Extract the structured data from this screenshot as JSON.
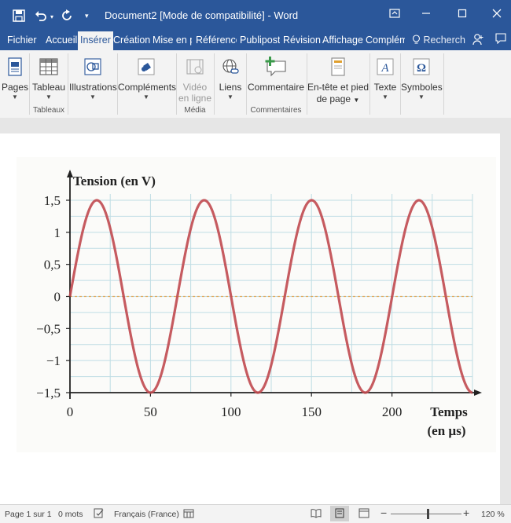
{
  "app": {
    "title": "Document2 [Mode de compatibilité]  -  Word"
  },
  "tabs": [
    {
      "label": "Fichier"
    },
    {
      "label": "Accueil"
    },
    {
      "label": "Insérer"
    },
    {
      "label": "Création"
    },
    {
      "label": "Mise en p"
    },
    {
      "label": "Référence"
    },
    {
      "label": "Publiposti"
    },
    {
      "label": "Révision"
    },
    {
      "label": "Affichage"
    },
    {
      "label": "Complém"
    }
  ],
  "tell_me": "Recherch",
  "ribbon": {
    "pages": "Pages",
    "tableau": "Tableau",
    "tableaux_group": "Tableaux",
    "illustrations": "Illustrations",
    "complements": "Compléments",
    "video_line1": "Vidéo",
    "video_line2": "en ligne",
    "media_group": "Média",
    "liens": "Liens",
    "commentaire": "Commentaire",
    "commentaires_group": "Commentaires",
    "entete_line1": "En-tête et pied",
    "entete_line2": "de page",
    "texte": "Texte",
    "symboles": "Symboles"
  },
  "status": {
    "page": "Page 1 sur 1",
    "words": "0 mots",
    "language": "Français (France)",
    "zoom": "120 %",
    "zoom_value": 120
  },
  "chart_data": {
    "type": "line",
    "ylabel": "Tension (en V)",
    "xlabel_line1": "Temps",
    "xlabel_line2": "(en µs)",
    "x_ticks": [
      0,
      50,
      100,
      150,
      200
    ],
    "y_ticks": [
      {
        "value": 1.5,
        "label": "1,5"
      },
      {
        "value": 1,
        "label": "1"
      },
      {
        "value": 0.5,
        "label": "0,5"
      },
      {
        "value": 0,
        "label": "0"
      },
      {
        "value": -0.5,
        "label": "−0,5"
      },
      {
        "value": -1,
        "label": "−1"
      },
      {
        "value": -1.5,
        "label": "−1,5"
      }
    ],
    "xlim": [
      0,
      250
    ],
    "ylim": [
      -1.5,
      1.5
    ],
    "grid": true,
    "series": [
      {
        "color": "#c0494f",
        "function": "sine",
        "amplitude": 1.5,
        "period": 66.7,
        "phase": 0,
        "x_end": 250
      }
    ]
  }
}
